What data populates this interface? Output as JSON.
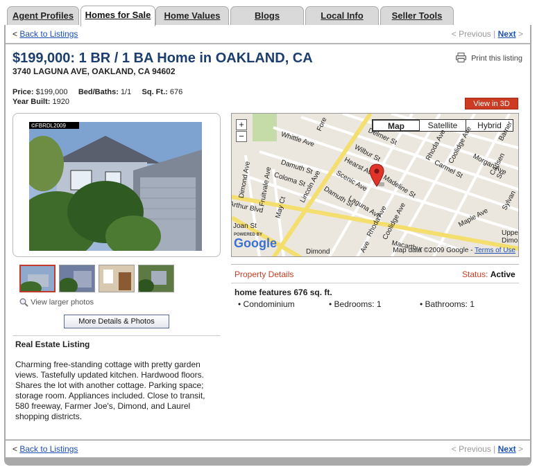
{
  "tabs": [
    {
      "label": "Agent Profiles"
    },
    {
      "label": "Homes for Sale"
    },
    {
      "label": "Home Values"
    },
    {
      "label": "Blogs"
    },
    {
      "label": "Local Info"
    },
    {
      "label": "Seller Tools"
    }
  ],
  "nav": {
    "back_prefix": "<",
    "back_label": "Back to Listings",
    "previous_label": "< Previous",
    "separator": "|",
    "next_label": "Next",
    "next_suffix": ">"
  },
  "listing": {
    "title": "$199,000: 1 BR / 1 BA Home in OAKLAND, CA",
    "address": "3740 LAGUNA AVE, OAKLAND, CA 94602",
    "print_label": "Print this listing",
    "price_label": "Price:",
    "price": "$199,000",
    "bedbath_label": "Bed/Baths:",
    "bedbath": "1/1",
    "sqft_label": "Sq. Ft.:",
    "sqft": "676",
    "year_label": "Year Built:",
    "year": "1920",
    "view3d_label": "View in 3D",
    "photo_watermark": "©FBRDL2009",
    "view_larger": "View larger photos",
    "more_button": "More Details & Photos",
    "section_head": "Real Estate Listing",
    "description": "Charming free-standing cottage with pretty garden views. Tastefully updated kitchen. Hardwood floors. Shares the lot with another cottage. Parking space; storage room. Appliances included. Close to transit, 580 freeway, Farmer Joe's, Dimond, and Laurel shopping districts."
  },
  "map": {
    "types": [
      "Map",
      "Satellite",
      "Hybrid"
    ],
    "selected_type": "Map",
    "zoom_in": "+",
    "zoom_out": "−",
    "google_logo": "Google",
    "powered_by": "POWERED BY",
    "credit": "Map data ©2009 Google -",
    "terms": "Terms of Use",
    "streets": [
      "Whittle Ave",
      "Fore",
      "Delmer St",
      "Wilbur St",
      "Hearst Ave",
      "Scenic Ave",
      "Damuth St",
      "Coloma St",
      "Dimond Ave",
      "Fruitvale Ave",
      "Lincoln Ave",
      "May Ct",
      "Laguna Ave",
      "Madeline St",
      "Rhoda Ave",
      "Coolidge Ave",
      "Carmel St",
      "Morgan Ave",
      "Barner",
      "Carlsen St",
      "Sylvan",
      "Maple Ave",
      "Arthur Blvd",
      "Joan St",
      "Damuth St",
      "Rhoda Ave",
      "Coolidge Ave",
      "Dimond",
      "Macarthur",
      "Upper Dimond",
      "Ave"
    ]
  },
  "details": {
    "heading": "Property Details",
    "status_label": "Status:",
    "status_value": "Active",
    "features_head": "home features 676 sq. ft.",
    "features": [
      "• Condominium",
      "• Bedrooms: 1",
      "• Bathrooms: 1"
    ]
  },
  "colors": {
    "accent": "#cc3b22",
    "title": "#1c3e6e",
    "link": "#1a4fb5"
  }
}
